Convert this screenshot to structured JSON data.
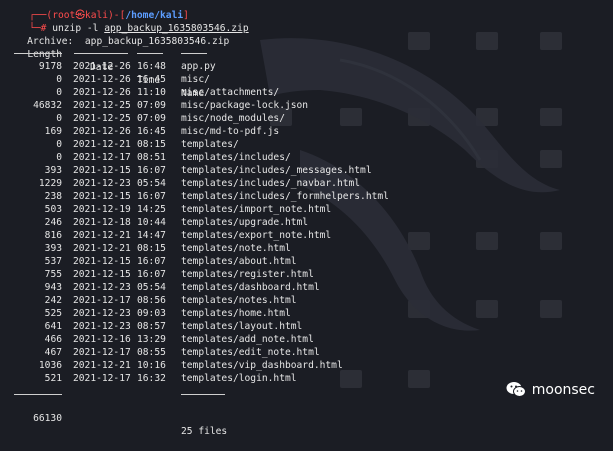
{
  "prompt": {
    "user_host": "root㉿kali",
    "path": "/home/kali",
    "symbol": "#",
    "command": "unzip -l",
    "argument": "app_backup_1635803546.zip"
  },
  "archive_label": "Archive:",
  "archive_name": "app_backup_1635803546.zip",
  "headers": {
    "length": "Length",
    "date": "Date",
    "time": "Time",
    "name": "Name"
  },
  "header_rule": "---------",
  "files": [
    {
      "length": "9178",
      "date": "2021-12-26",
      "time": "16:48",
      "name": "app.py"
    },
    {
      "length": "0",
      "date": "2021-12-26",
      "time": "16:45",
      "name": "misc/"
    },
    {
      "length": "0",
      "date": "2021-12-26",
      "time": "11:10",
      "name": "misc/attachments/"
    },
    {
      "length": "46832",
      "date": "2021-12-25",
      "time": "07:09",
      "name": "misc/package-lock.json"
    },
    {
      "length": "0",
      "date": "2021-12-25",
      "time": "07:09",
      "name": "misc/node_modules/"
    },
    {
      "length": "169",
      "date": "2021-12-26",
      "time": "16:45",
      "name": "misc/md-to-pdf.js"
    },
    {
      "length": "0",
      "date": "2021-12-21",
      "time": "08:15",
      "name": "templates/"
    },
    {
      "length": "0",
      "date": "2021-12-17",
      "time": "08:51",
      "name": "templates/includes/"
    },
    {
      "length": "393",
      "date": "2021-12-15",
      "time": "16:07",
      "name": "templates/includes/_messages.html"
    },
    {
      "length": "1229",
      "date": "2021-12-23",
      "time": "05:54",
      "name": "templates/includes/_navbar.html"
    },
    {
      "length": "238",
      "date": "2021-12-15",
      "time": "16:07",
      "name": "templates/includes/_formhelpers.html"
    },
    {
      "length": "503",
      "date": "2021-12-19",
      "time": "14:25",
      "name": "templates/import_note.html"
    },
    {
      "length": "246",
      "date": "2021-12-18",
      "time": "10:44",
      "name": "templates/upgrade.html"
    },
    {
      "length": "816",
      "date": "2021-12-21",
      "time": "14:47",
      "name": "templates/export_note.html"
    },
    {
      "length": "393",
      "date": "2021-12-21",
      "time": "08:15",
      "name": "templates/note.html"
    },
    {
      "length": "537",
      "date": "2021-12-15",
      "time": "16:07",
      "name": "templates/about.html"
    },
    {
      "length": "755",
      "date": "2021-12-15",
      "time": "16:07",
      "name": "templates/register.html"
    },
    {
      "length": "943",
      "date": "2021-12-23",
      "time": "05:54",
      "name": "templates/dashboard.html"
    },
    {
      "length": "242",
      "date": "2021-12-17",
      "time": "08:56",
      "name": "templates/notes.html"
    },
    {
      "length": "525",
      "date": "2021-12-23",
      "time": "09:03",
      "name": "templates/home.html"
    },
    {
      "length": "641",
      "date": "2021-12-23",
      "time": "08:57",
      "name": "templates/layout.html"
    },
    {
      "length": "466",
      "date": "2021-12-16",
      "time": "13:29",
      "name": "templates/add_note.html"
    },
    {
      "length": "467",
      "date": "2021-12-17",
      "time": "08:55",
      "name": "templates/edit_note.html"
    },
    {
      "length": "1036",
      "date": "2021-12-21",
      "time": "10:16",
      "name": "templates/vip_dashboard.html"
    },
    {
      "length": "521",
      "date": "2021-12-17",
      "time": "16:32",
      "name": "templates/login.html"
    }
  ],
  "totals": {
    "length": "66130",
    "files": "25 files"
  },
  "watermark": {
    "text": "moonsec",
    "icon": "wechat-icon"
  },
  "colors": {
    "background": "#1b1d24",
    "prompt_red": "#ff4c4c",
    "path_blue": "#5c9dff",
    "text": "#e6e6e6"
  }
}
